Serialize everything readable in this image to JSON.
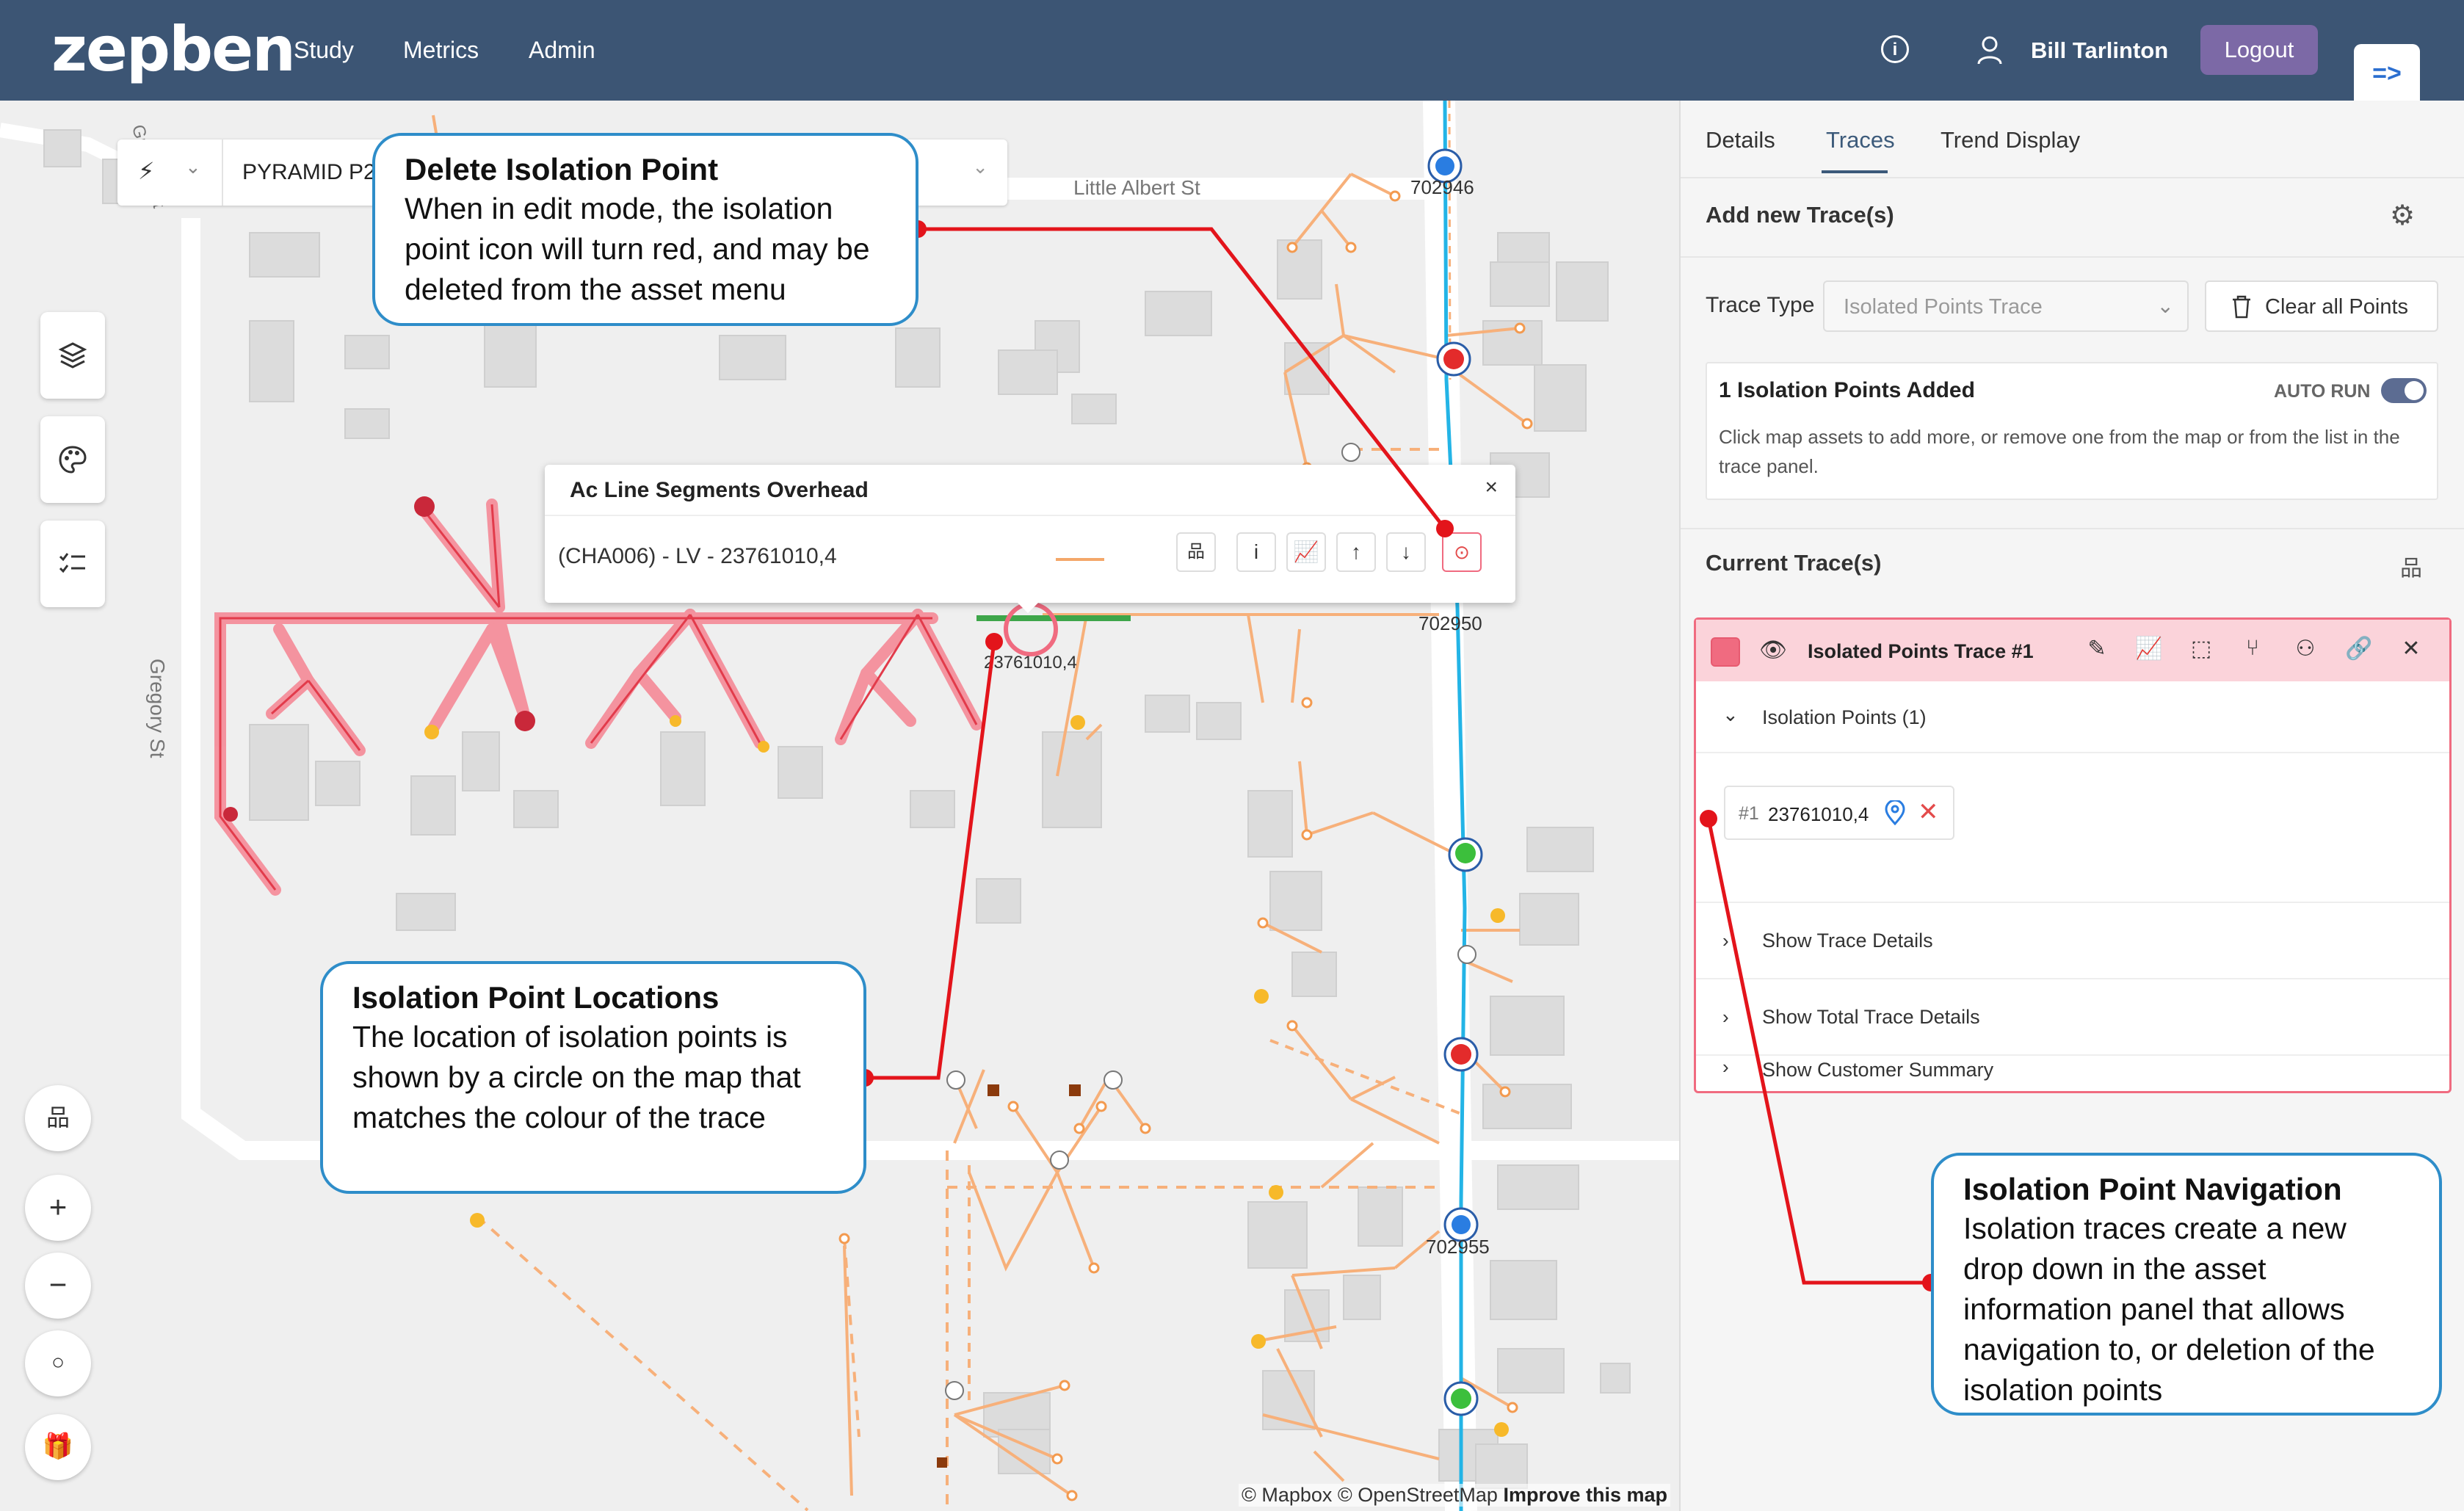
{
  "header": {
    "logo": "zepben",
    "nav": [
      "Study",
      "Metrics",
      "Admin"
    ],
    "user_name": "Bill Tarlinton",
    "logout_label": "Logout"
  },
  "map": {
    "search_text": "PYRAMID P2",
    "street_labels": [
      "Little Albert St",
      "Gregory St",
      "Gregory St"
    ],
    "asset_labels": [
      "702946",
      "702950",
      "702955",
      "23761010,4"
    ],
    "attribution_1": "© Mapbox © OpenStreetMap",
    "attribution_2": "Improve this map"
  },
  "popup": {
    "title": "Ac Line Segments Overhead",
    "asset_id": "(CHA006) - LV - 23761010,4",
    "close": "×",
    "info_label": "i"
  },
  "panel": {
    "tabs": [
      "Details",
      "Traces",
      "Trend Display"
    ],
    "add_trace_title": "Add new Trace(s)",
    "trace_type_label": "Trace Type",
    "trace_type_value": "Isolated Points Trace",
    "clear_label": "Clear all Points",
    "iso_title": "1 Isolation Points Added",
    "auto_run_label": "AUTO RUN",
    "auto_run_on": true,
    "iso_help": "Click map assets to add more, or remove one from the map or from the list in the trace panel.",
    "current_title": "Current Trace(s)",
    "trace": {
      "color": "#f06b80",
      "name": "Isolated Points Trace #1",
      "iso_points_label": "Isolation Points (1)",
      "chip_num": "#1",
      "chip_id": "23761010,4",
      "rows": [
        "Show Trace Details",
        "Show Total Trace Details",
        "Show Customer Summary"
      ]
    }
  },
  "callouts": {
    "delete": {
      "title": "Delete Isolation Point",
      "text": "When in edit mode, the isolation point icon will turn red, and may be deleted from the asset menu"
    },
    "locations": {
      "title": "Isolation Point Locations",
      "text": "The location of isolation points is shown by a circle on the map that matches the colour of the trace"
    },
    "navigation": {
      "title": "Isolation Point Navigation",
      "text": "Isolation traces create a new drop down in the asset information panel that allows navigation to, or deletion of the isolation points"
    }
  },
  "colors": {
    "topbar": "#3c5574",
    "trace": "#f06b80",
    "callout_border": "#2e8dc9",
    "callout_line": "#e3141b",
    "feeder": "#23b4e6"
  }
}
